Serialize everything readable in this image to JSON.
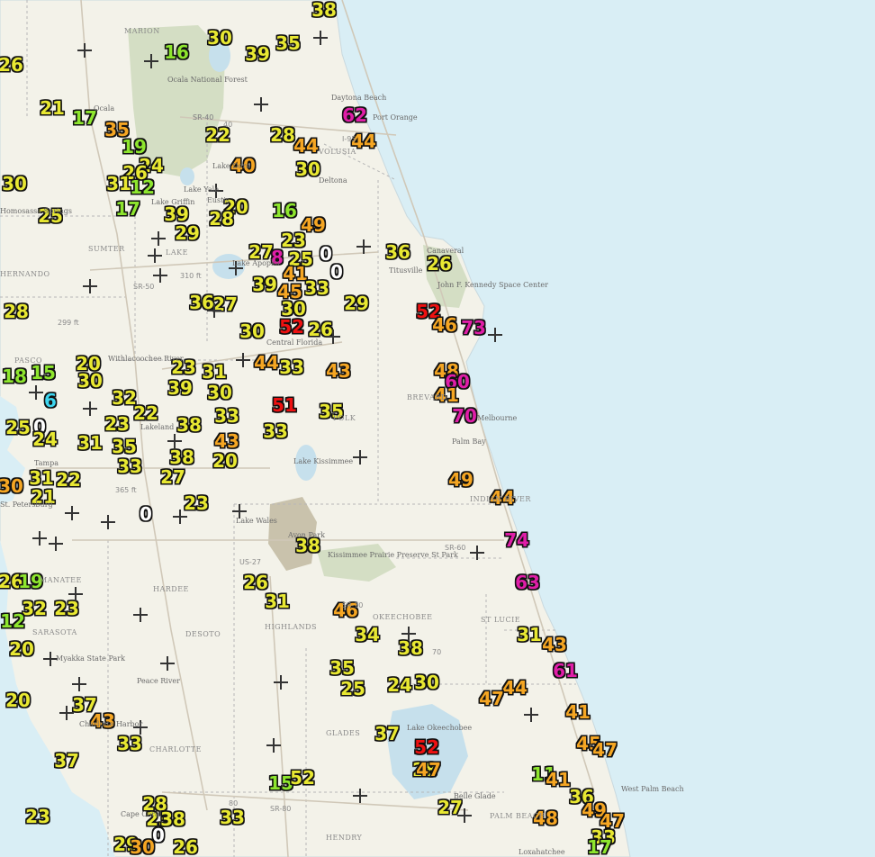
{
  "colors": {
    "ocean": "#d9eef5",
    "land": "#f3f2e9",
    "park": "#d4dec4",
    "lake": "#c6e0ec",
    "urban": "#e5e2d6",
    "value_0": "#ffffff",
    "value_cyan": "#3ed6f0",
    "value_green": "#8ee62e",
    "value_yellow": "#e8e832",
    "value_orange": "#f5a623",
    "value_red": "#ee1111",
    "value_magenta": "#e01ea8"
  },
  "stations": [
    {
      "v": "38",
      "c": "yellow"
    },
    {
      "v": "16",
      "c": "green"
    },
    {
      "v": "30",
      "c": "yellow"
    },
    {
      "v": "39",
      "c": "yellow"
    },
    {
      "v": "35",
      "c": "yellow"
    },
    {
      "v": "26",
      "c": "yellow"
    },
    {
      "v": "62",
      "c": "magenta"
    },
    {
      "v": "21",
      "c": "yellow"
    },
    {
      "v": "17",
      "c": "green"
    },
    {
      "v": "35",
      "c": "orange"
    },
    {
      "v": "22",
      "c": "yellow"
    },
    {
      "v": "28",
      "c": "yellow"
    },
    {
      "v": "44",
      "c": "orange"
    },
    {
      "v": "44",
      "c": "orange"
    },
    {
      "v": "19",
      "c": "green"
    },
    {
      "v": "24",
      "c": "yellow"
    },
    {
      "v": "26",
      "c": "yellow"
    },
    {
      "v": "40",
      "c": "orange"
    },
    {
      "v": "30",
      "c": "yellow"
    },
    {
      "v": "31",
      "c": "yellow"
    },
    {
      "v": "12",
      "c": "green"
    },
    {
      "v": "30",
      "c": "yellow"
    },
    {
      "v": "25",
      "c": "yellow"
    },
    {
      "v": "17",
      "c": "green"
    },
    {
      "v": "39",
      "c": "yellow"
    },
    {
      "v": "20",
      "c": "yellow"
    },
    {
      "v": "28",
      "c": "yellow"
    },
    {
      "v": "16",
      "c": "green"
    },
    {
      "v": "29",
      "c": "yellow"
    },
    {
      "v": "49",
      "c": "orange"
    },
    {
      "v": "23",
      "c": "yellow"
    },
    {
      "v": "0",
      "c": "white"
    },
    {
      "v": "27",
      "c": "yellow"
    },
    {
      "v": "8",
      "c": "magenta"
    },
    {
      "v": "25",
      "c": "yellow"
    },
    {
      "v": "36",
      "c": "yellow"
    },
    {
      "v": "26",
      "c": "yellow"
    },
    {
      "v": "41",
      "c": "orange"
    },
    {
      "v": "0",
      "c": "white"
    },
    {
      "v": "39",
      "c": "yellow"
    },
    {
      "v": "45",
      "c": "orange"
    },
    {
      "v": "33",
      "c": "yellow"
    },
    {
      "v": "29",
      "c": "yellow"
    },
    {
      "v": "36",
      "c": "yellow"
    },
    {
      "v": "27",
      "c": "yellow"
    },
    {
      "v": "28",
      "c": "yellow"
    },
    {
      "v": "30",
      "c": "yellow"
    },
    {
      "v": "52",
      "c": "red"
    },
    {
      "v": "46",
      "c": "orange"
    },
    {
      "v": "73",
      "c": "magenta"
    },
    {
      "v": "30",
      "c": "yellow"
    },
    {
      "v": "52",
      "c": "red"
    },
    {
      "v": "26",
      "c": "yellow"
    },
    {
      "v": "20",
      "c": "yellow"
    },
    {
      "v": "30",
      "c": "yellow"
    },
    {
      "v": "18",
      "c": "green"
    },
    {
      "v": "15",
      "c": "green"
    },
    {
      "v": "23",
      "c": "yellow"
    },
    {
      "v": "31",
      "c": "yellow"
    },
    {
      "v": "44",
      "c": "orange"
    },
    {
      "v": "33",
      "c": "yellow"
    },
    {
      "v": "43",
      "c": "orange"
    },
    {
      "v": "48",
      "c": "orange"
    },
    {
      "v": "60",
      "c": "magenta"
    },
    {
      "v": "41",
      "c": "orange"
    },
    {
      "v": "6",
      "c": "cyan"
    },
    {
      "v": "32",
      "c": "yellow"
    },
    {
      "v": "39",
      "c": "yellow"
    },
    {
      "v": "30",
      "c": "yellow"
    },
    {
      "v": "51",
      "c": "red"
    },
    {
      "v": "35",
      "c": "yellow"
    },
    {
      "v": "70",
      "c": "magenta"
    },
    {
      "v": "22",
      "c": "yellow"
    },
    {
      "v": "23",
      "c": "yellow"
    },
    {
      "v": "38",
      "c": "yellow"
    },
    {
      "v": "33",
      "c": "yellow"
    },
    {
      "v": "33",
      "c": "yellow"
    },
    {
      "v": "25",
      "c": "yellow"
    },
    {
      "v": "0",
      "c": "white"
    },
    {
      "v": "24",
      "c": "yellow"
    },
    {
      "v": "31",
      "c": "yellow"
    },
    {
      "v": "35",
      "c": "yellow"
    },
    {
      "v": "43",
      "c": "orange"
    },
    {
      "v": "38",
      "c": "yellow"
    },
    {
      "v": "33",
      "c": "yellow"
    },
    {
      "v": "20",
      "c": "yellow"
    },
    {
      "v": "27",
      "c": "yellow"
    },
    {
      "v": "31",
      "c": "yellow"
    },
    {
      "v": "22",
      "c": "yellow"
    },
    {
      "v": "21",
      "c": "yellow"
    },
    {
      "v": "30",
      "c": "orange"
    },
    {
      "v": "49",
      "c": "orange"
    },
    {
      "v": "44",
      "c": "orange"
    },
    {
      "v": "23",
      "c": "yellow"
    },
    {
      "v": "0",
      "c": "white"
    },
    {
      "v": "74",
      "c": "magenta"
    },
    {
      "v": "38",
      "c": "yellow"
    },
    {
      "v": "26",
      "c": "yellow"
    },
    {
      "v": "19",
      "c": "green"
    },
    {
      "v": "63",
      "c": "magenta"
    },
    {
      "v": "26",
      "c": "yellow"
    },
    {
      "v": "31",
      "c": "yellow"
    },
    {
      "v": "32",
      "c": "yellow"
    },
    {
      "v": "23",
      "c": "yellow"
    },
    {
      "v": "46",
      "c": "orange"
    },
    {
      "v": "12",
      "c": "green"
    },
    {
      "v": "34",
      "c": "yellow"
    },
    {
      "v": "31",
      "c": "yellow"
    },
    {
      "v": "43",
      "c": "orange"
    },
    {
      "v": "20",
      "c": "yellow"
    },
    {
      "v": "38",
      "c": "yellow"
    },
    {
      "v": "61",
      "c": "magenta"
    },
    {
      "v": "35",
      "c": "yellow"
    },
    {
      "v": "25",
      "c": "yellow"
    },
    {
      "v": "24",
      "c": "yellow"
    },
    {
      "v": "30",
      "c": "yellow"
    },
    {
      "v": "44",
      "c": "orange"
    },
    {
      "v": "47",
      "c": "orange"
    },
    {
      "v": "41",
      "c": "orange"
    },
    {
      "v": "37",
      "c": "yellow"
    },
    {
      "v": "20",
      "c": "yellow"
    },
    {
      "v": "43",
      "c": "orange"
    },
    {
      "v": "33",
      "c": "yellow"
    },
    {
      "v": "37",
      "c": "yellow"
    },
    {
      "v": "37",
      "c": "yellow"
    },
    {
      "v": "45",
      "c": "orange"
    },
    {
      "v": "47",
      "c": "orange"
    },
    {
      "v": "52",
      "c": "red"
    },
    {
      "v": "28",
      "c": "yellow"
    },
    {
      "v": "47",
      "c": "orange"
    },
    {
      "v": "15",
      "c": "green"
    },
    {
      "v": "52",
      "c": "yellow"
    },
    {
      "v": "11",
      "c": "green"
    },
    {
      "v": "41",
      "c": "orange"
    },
    {
      "v": "28",
      "c": "yellow"
    },
    {
      "v": "27",
      "c": "yellow"
    },
    {
      "v": "36",
      "c": "yellow"
    },
    {
      "v": "49",
      "c": "orange"
    },
    {
      "v": "23",
      "c": "yellow"
    },
    {
      "v": "33",
      "c": "yellow"
    },
    {
      "v": "23",
      "c": "yellow"
    },
    {
      "v": "38",
      "c": "yellow"
    },
    {
      "v": "48",
      "c": "orange"
    },
    {
      "v": "47",
      "c": "orange"
    },
    {
      "v": "0",
      "c": "white"
    },
    {
      "v": "29",
      "c": "yellow"
    },
    {
      "v": "30",
      "c": "orange"
    },
    {
      "v": "26",
      "c": "yellow"
    },
    {
      "v": "33",
      "c": "yellow"
    },
    {
      "v": "17",
      "c": "green"
    }
  ],
  "labels": {
    "places": [
      "Ocala National Forest",
      "Daytona Beach",
      "Port Orange",
      "Deltona",
      "Eustis",
      "Titusville",
      "Canaveral",
      "John F. Kennedy Space Center",
      "Lakeland",
      "Tampa",
      "Melbourne",
      "Palm Bay",
      "Kissimmee Prairie Preserve St Park",
      "Avon Park",
      "Myakka State Park",
      "Cape Coral",
      "West Palm Beach",
      "Belle Glade",
      "Ocala",
      "Lake Apopka",
      "Lake Kissimmee",
      "Lake Okeechobee",
      "Central Florida",
      "Lake Yale",
      "Lake Griffin",
      "Lake Dora",
      "Loxahatchee",
      "Peace River",
      "Withlacoochee River",
      "Homosassa Springs",
      "Lake Wales",
      "St. Petersburg",
      "Charlotte Harbor"
    ],
    "counties": [
      "MARION",
      "VOLUSIA",
      "SUMTER",
      "LAKE",
      "PASCO",
      "HARDEE",
      "DESOTO",
      "HIGHLANDS",
      "OKEECHOBEE",
      "ST LUCIE",
      "CHARLOTTE",
      "GLADES",
      "HENDRY",
      "PALM BEACH",
      "MANATEE",
      "SARASOTA",
      "HERNANDO",
      "BREVARD",
      "POLK",
      "INDIAN RIVER"
    ],
    "roads": [
      "SR-40",
      "SR-50",
      "SR-60",
      "SR-70",
      "SR-80",
      "310 ft",
      "365 ft",
      "299 ft",
      "US-27",
      "I-95",
      "40",
      "80",
      "70",
      "SR-40 "
    ]
  }
}
